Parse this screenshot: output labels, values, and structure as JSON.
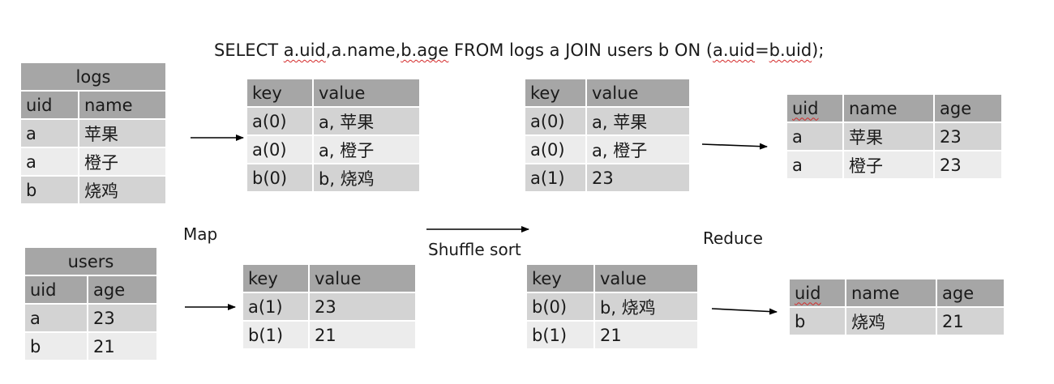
{
  "query": {
    "parts": [
      {
        "text": "SELECT ",
        "wavy": false
      },
      {
        "text": "a.uid",
        "wavy": true
      },
      {
        "text": ",a.name,",
        "wavy": false
      },
      {
        "text": "b.age",
        "wavy": true
      },
      {
        "text": " FROM logs a JOIN users b ON (",
        "wavy": false
      },
      {
        "text": "a.uid",
        "wavy": true
      },
      {
        "text": "=",
        "wavy": false
      },
      {
        "text": "b.uid",
        "wavy": true
      },
      {
        "text": ");",
        "wavy": false
      }
    ]
  },
  "labels": {
    "map": "Map",
    "shuffle": "Shuffle sort",
    "reduce": "Reduce"
  },
  "logs_table": {
    "title": "logs",
    "headers": [
      "uid",
      "name"
    ],
    "rows": [
      [
        "a",
        "苹果"
      ],
      [
        "a",
        "橙子"
      ],
      [
        "b",
        "烧鸡"
      ]
    ]
  },
  "users_table": {
    "title": "users",
    "headers": [
      "uid",
      "age"
    ],
    "rows": [
      [
        "a",
        "23"
      ],
      [
        "b",
        "21"
      ]
    ]
  },
  "map_out_logs": {
    "headers": [
      "key",
      "value"
    ],
    "rows": [
      [
        "a(0)",
        "a, 苹果"
      ],
      [
        "a(0)",
        "a, 橙子"
      ],
      [
        "b(0)",
        "b, 烧鸡"
      ]
    ]
  },
  "map_out_users": {
    "headers": [
      "key",
      "value"
    ],
    "rows": [
      [
        "a(1)",
        "23"
      ],
      [
        "b(1)",
        "21"
      ]
    ]
  },
  "shuffle_a": {
    "headers": [
      "key",
      "value"
    ],
    "rows": [
      [
        "a(0)",
        "a, 苹果"
      ],
      [
        "a(0)",
        "a, 橙子"
      ],
      [
        "a(1)",
        "23"
      ]
    ]
  },
  "shuffle_b": {
    "headers": [
      "key",
      "value"
    ],
    "rows": [
      [
        "b(0)",
        "b, 烧鸡"
      ],
      [
        "b(1)",
        "21"
      ]
    ]
  },
  "result_a": {
    "headers": [
      "uid",
      "name",
      "age"
    ],
    "wavy_header": "uid",
    "rows": [
      [
        "a",
        "苹果",
        "23"
      ],
      [
        "a",
        "橙子",
        "23"
      ]
    ]
  },
  "result_b": {
    "headers": [
      "uid",
      "name",
      "age"
    ],
    "wavy_header": "uid",
    "rows": [
      [
        "b",
        "烧鸡",
        "21"
      ]
    ]
  }
}
